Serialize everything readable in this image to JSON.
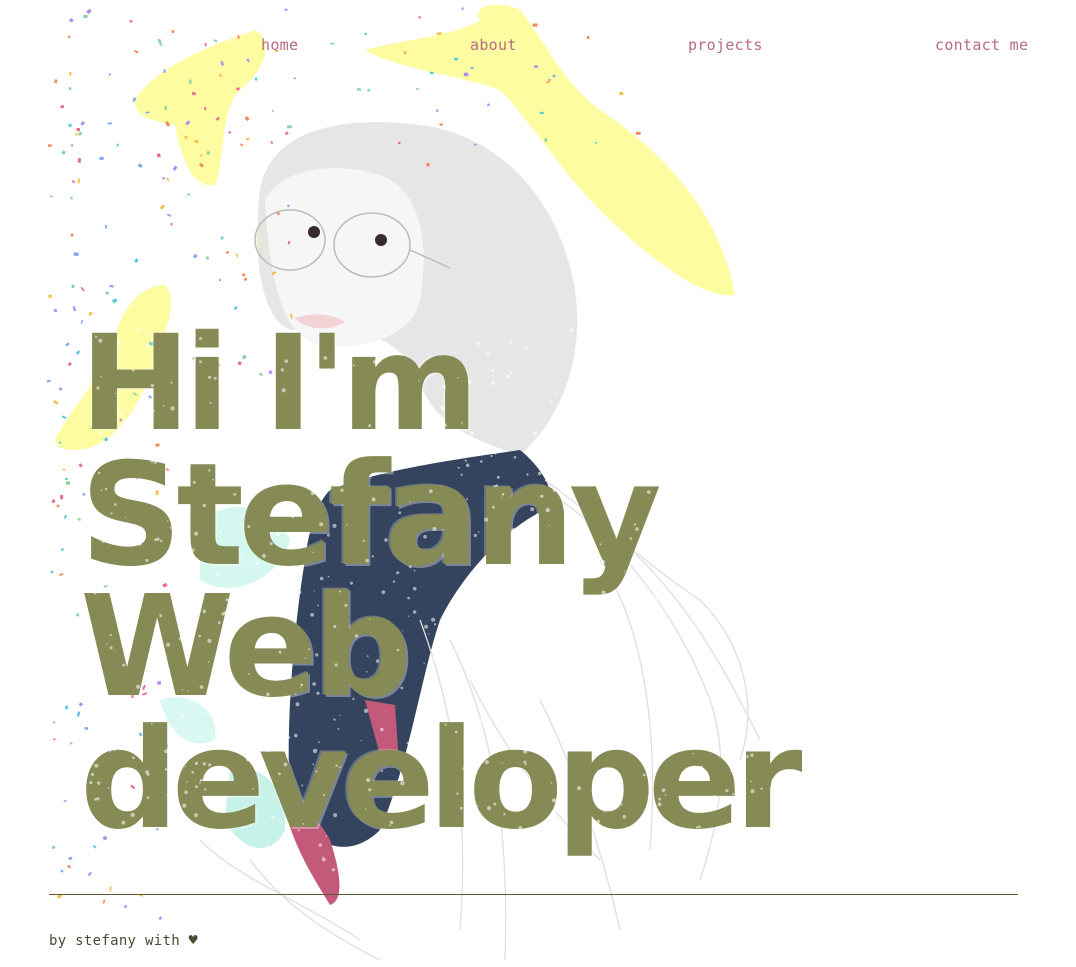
{
  "nav": {
    "home": "home",
    "about": "about",
    "projects": "projects",
    "contact": "contact me"
  },
  "hero": {
    "line1": "Hi I'm",
    "line2": "Stefany",
    "line3": "Web",
    "line4": "developer"
  },
  "footer": {
    "text": "by stefany with",
    "heart": "♥"
  },
  "colors": {
    "nav_link": "#b76a84",
    "headline": "#868a55",
    "banana_yellow": "#fefca0",
    "jacket_navy": "#35445e",
    "tie_pink": "#c45a7a",
    "footer_text": "#4a4a33"
  },
  "icons": {
    "heart": "heart-icon",
    "confetti": "confetti-decoration"
  }
}
